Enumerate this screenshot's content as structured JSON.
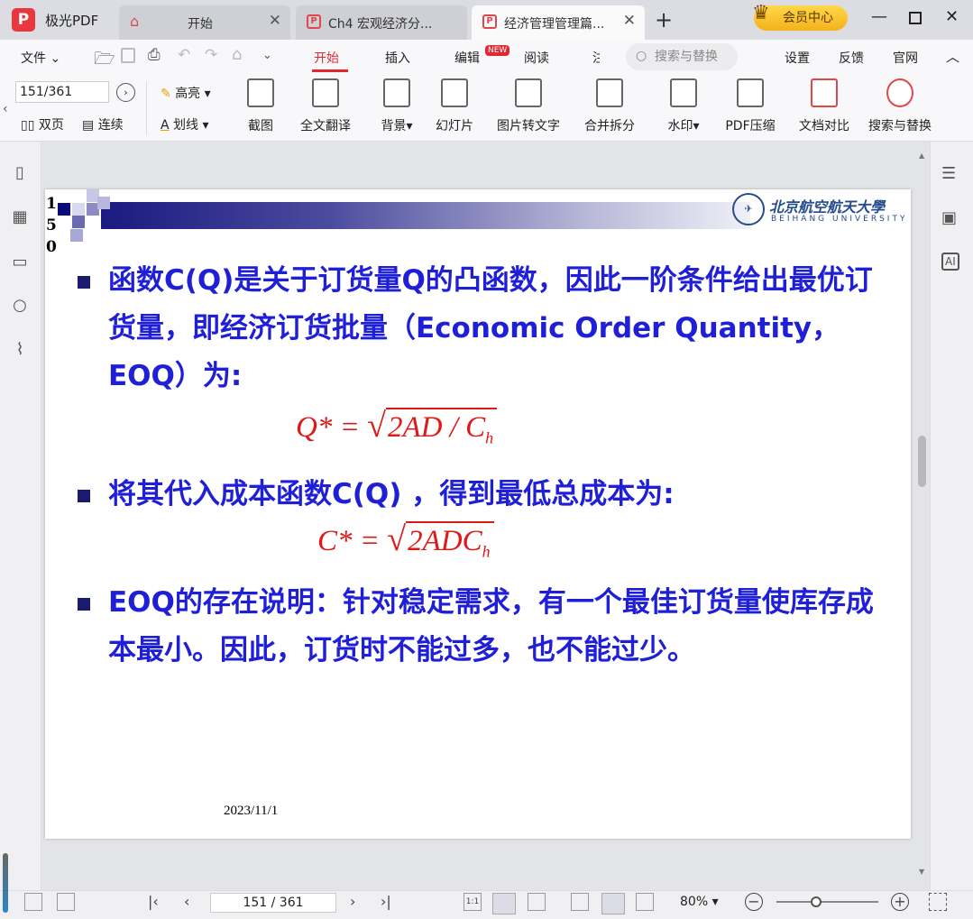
{
  "app": {
    "name": "极光PDF"
  },
  "tabs": [
    {
      "label": "开始"
    },
    {
      "label": "Ch4 宏观经济分..."
    },
    {
      "label": "经济管理管理篇..."
    }
  ],
  "vip": {
    "label": "会员中心"
  },
  "menu": {
    "file": "文件",
    "start": "开始",
    "insert": "插入",
    "edit": "编辑",
    "edit_badge": "NEW",
    "read": "阅读",
    "more": "注",
    "search_placeholder": "搜索与替换",
    "settings": "设置",
    "feedback": "反馈",
    "website": "官网"
  },
  "toolbar": {
    "page_value": "151/361",
    "highlight": "高亮",
    "underline": "划线",
    "double_page": "双页",
    "continuous": "连续",
    "tools": [
      "截图",
      "全文翻译",
      "背景",
      "幻灯片",
      "图片转文字",
      "合并拆分",
      "水印",
      "PDF压缩",
      "文档对比",
      "搜索与替换"
    ]
  },
  "slide": {
    "page_number_lines": [
      "1",
      "5",
      "0"
    ],
    "logo_cn": "北京航空航天大學",
    "logo_en": "BEIHANG UNIVERSITY",
    "para1": "函数C(Q)是关于订货量Q的凸函数，因此一阶条件给出最优订货量，即经济订货批量（Economic Order Quantity，EOQ）为:",
    "formula1_lhs": "Q* =",
    "formula1_rad": "2AD / C",
    "formula1_sub": "h",
    "para2": "将其代入成本函数C(Q) ，得到最低总成本为:",
    "formula2_lhs": "C* =",
    "formula2_rad": "2ADC",
    "formula2_sub": "h",
    "para3": "EOQ的存在说明：针对稳定需求，有一个最佳订货量使库存成本最小。因此，订货时不能过多，也不能过少。",
    "date": "2023/11/1"
  },
  "status": {
    "page_value": "151 / 361",
    "zoom": "80%"
  },
  "colors": {
    "accent": "#e0282e",
    "slide_text": "#1f1fd8",
    "formula": "#e01818",
    "vip": "#f3b21a"
  }
}
